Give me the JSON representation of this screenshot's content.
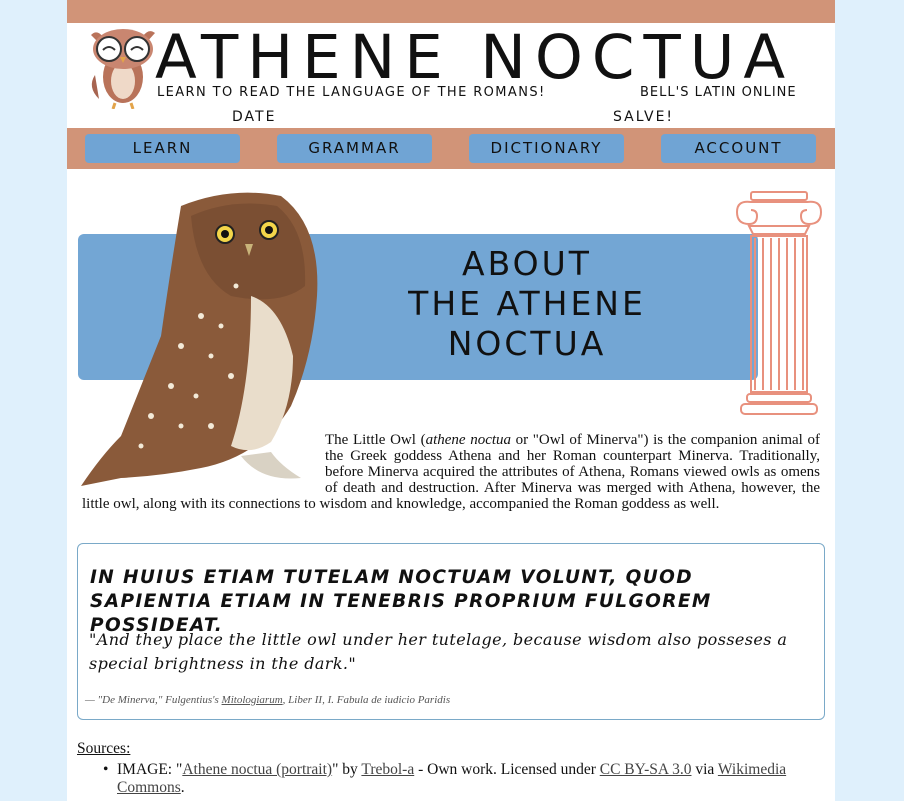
{
  "header": {
    "title": "ATHENE NOCTUA",
    "tagline": "LEARN TO READ THE LANGUAGE OF THE ROMANS!",
    "tagline_right": "BELL'S LATIN ONLINE",
    "date_label": "DATE",
    "greeting": "SALVE!"
  },
  "nav": {
    "items": [
      {
        "label": "LEARN"
      },
      {
        "label": "GRAMMAR"
      },
      {
        "label": "DICTIONARY"
      },
      {
        "label": "ACCOUNT"
      }
    ]
  },
  "about": {
    "title_line1": "ABOUT",
    "title_line2": "THE ATHENE",
    "title_line3": "NOCTUA",
    "intro_1": "The Little Owl (",
    "intro_italic": "athene noctua",
    "intro_2": " or \"Owl of Minerva\") is the companion animal of the Greek goddess Athena and her Roman counterpart Minerva. Traditionally, before Minerva acquired the attributes of Athena, Romans viewed owls as omens of death and destruction. After Minerva was merged with Athena, however, the little owl, along with its connections to wisdom and knowledge, accompanied the Roman goddess as well."
  },
  "quote": {
    "latin": "in huius etiam tutelam noctuam volunt, quod sapientia etiam in tenebris proprium fulgorem possideat.",
    "translation": "\"And they place the little owl under her tutelage, because wisdom also posseses a special brightness in the dark.\"",
    "citation_prefix": "— \"De Minerva,\" Fulgentius's ",
    "citation_link": "Mitologiarum",
    "citation_suffix": ", Liber II, I. Fabula de iudicio Paridis"
  },
  "sources": {
    "heading": "Sources:",
    "item_prefix": "IMAGE: \"",
    "link1": "Athene noctua (portrait)",
    "mid1": "\" by ",
    "link2": "Trebol-a",
    "mid2": " - Own work. Licensed under ",
    "link3": "CC BY-SA 3.0",
    "mid3": " via ",
    "link4": "Wikimedia Commons",
    "end": "."
  },
  "colors": {
    "page_bg": "#dff0fc",
    "bar": "#d19478",
    "nav_button": "#70a4d4",
    "about_band": "#73a6d4",
    "column": "#e8917e"
  }
}
